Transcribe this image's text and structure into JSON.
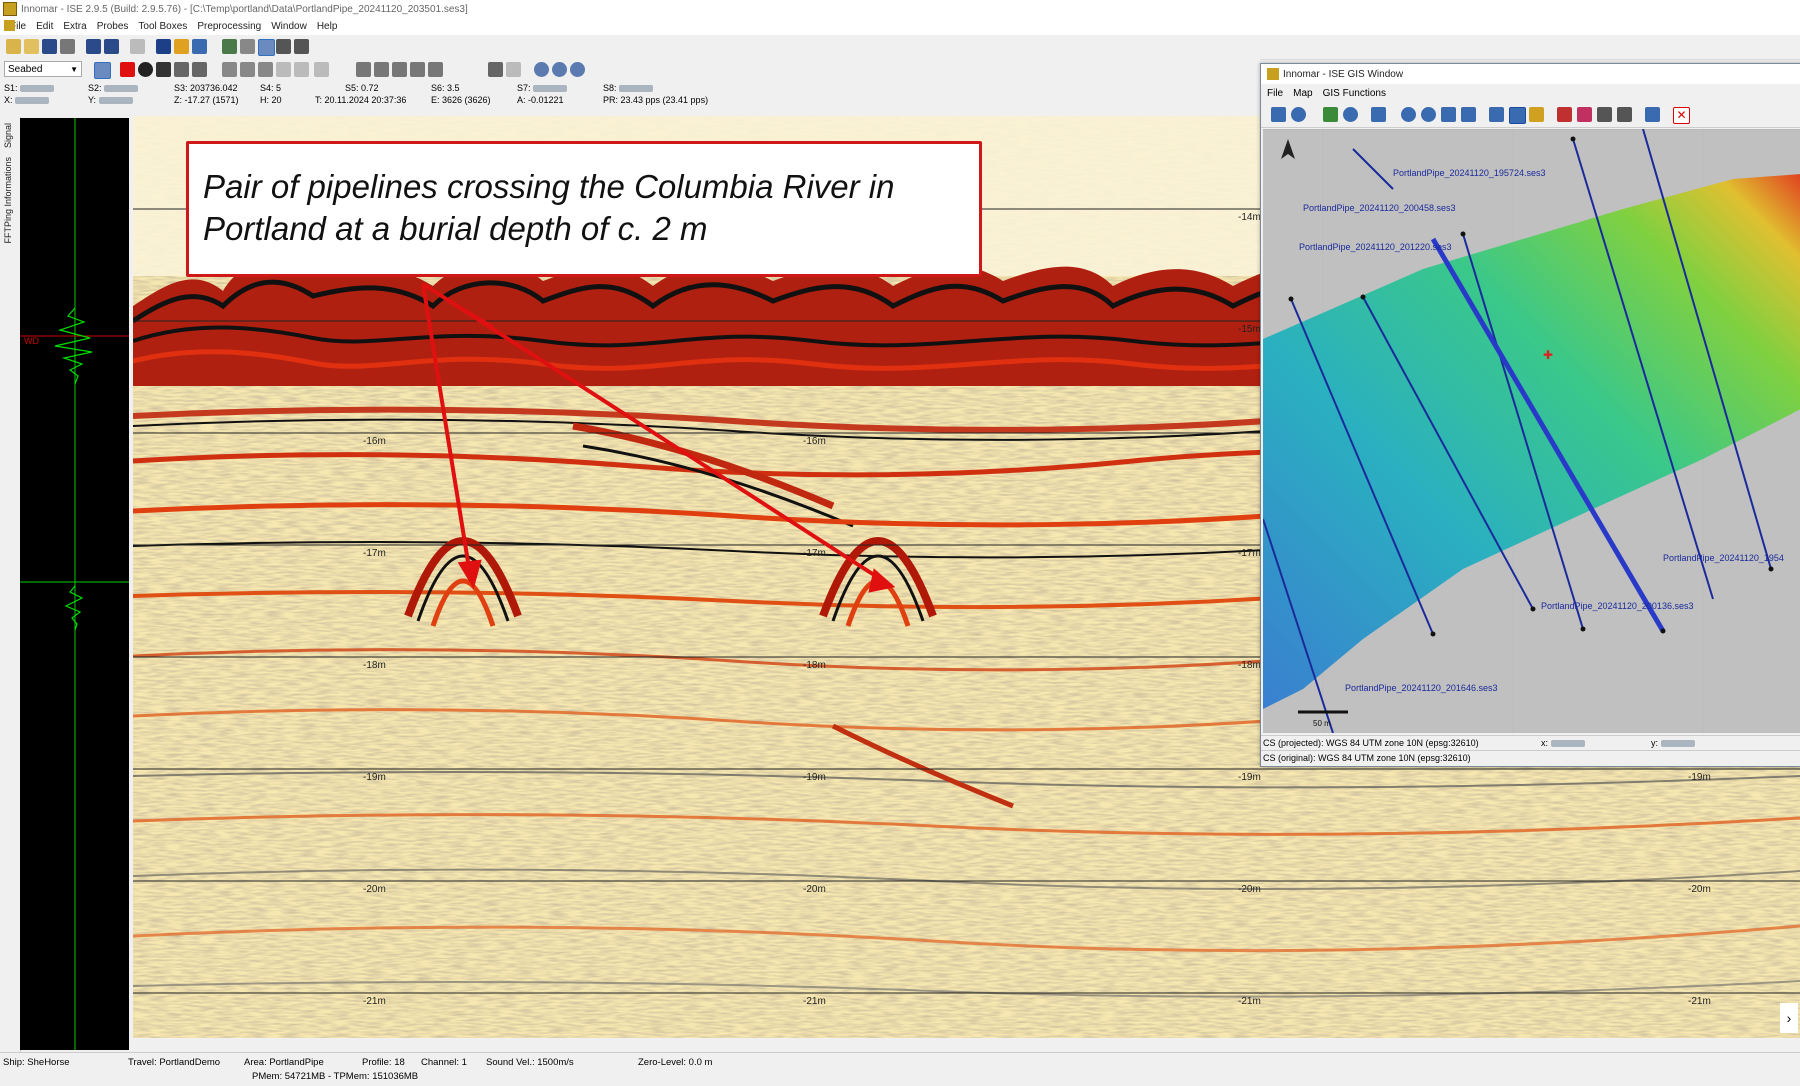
{
  "window": {
    "title": "Innomar - ISE 2.9.5 (Build: 2.9.5.76) - [C:\\Temp\\portland\\Data\\PortlandPipe_20241120_203501.ses3]"
  },
  "menu": [
    "File",
    "Edit",
    "Extra",
    "Probes",
    "Tool Boxes",
    "Preprocessing",
    "Window",
    "Help"
  ],
  "toolbar": {
    "layer_select": "Seabed"
  },
  "status": {
    "s1_label": "S1:",
    "x_label": "X:",
    "s2_label": "S2:",
    "y_label": "Y:",
    "s3": "S3: 203736.042",
    "z": "Z: -17.27 (1571)",
    "s4": "S4: 5",
    "h": "H: 20",
    "s5": "S5: 0.72",
    "t": "T: 20.11.2024 20:37:36",
    "s6": "S6: 3.5",
    "e": "E: 3626 (3626)",
    "s7_label": "S7:",
    "a": "A: -0.01221",
    "s8_label": "S8:",
    "pr": "PR: 23.43 pps (23.41 pps)"
  },
  "side_tabs": [
    "Signal",
    "Ping Informations",
    "FFT"
  ],
  "signal_marker": "WD",
  "echogram": {
    "depth_labels": [
      "-14m",
      "-15m",
      "-16m",
      "-17m",
      "-18m",
      "-19m",
      "-20m",
      "-21m"
    ],
    "line_color": "#222222"
  },
  "callout": {
    "line1": "Pair of pipelines crossing the Columbia River in",
    "line2": "Portland at a burial depth of c. 2 m",
    "border_color": "#d01818",
    "arrow_color": "#e01010"
  },
  "gis": {
    "title": "Innomar - ISE GIS Window",
    "menu": [
      "File",
      "Map",
      "GIS Functions"
    ],
    "track_labels": [
      "PortlandPipe_20241120_195724.ses3",
      "PortlandPipe_20241120_200458.ses3",
      "PortlandPipe_20241120_201220.ses3",
      "PortlandPipe_20241120_1954",
      "PortlandPipe_20241120_200136.ses3",
      "PortlandPipe_20241120_201646.ses3"
    ],
    "scale_label": "50 m",
    "cs_projected": "CS (projected): WGS 84 UTM zone 10N (epsg:32610)",
    "cs_original": "CS (original): WGS 84 UTM zone 10N (epsg:32610)",
    "x_label": "x:",
    "y_label": "y:",
    "north_icon": "north-arrow-icon"
  },
  "bottom": {
    "ship": "Ship: SheHorse",
    "travel": "Travel: PortlandDemo",
    "area": "Area: PortlandPipe",
    "profile": "Profile: 18",
    "channel": "Channel: 1",
    "sound_vel": "Sound Vel.: 1500m/s",
    "zero_level": "Zero-Level: 0.0 m",
    "pmem": "PMem: 54721MB - TPMem: 151036MB"
  }
}
